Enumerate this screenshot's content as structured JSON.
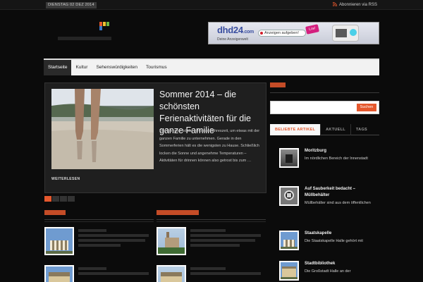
{
  "topbar": {
    "date": "DIENSTAG 02 DEZ 2014",
    "rss_label": "Abonnieren via RSS"
  },
  "header": {
    "logo_colors": [
      "#e5582d",
      "#f2c230",
      "#6cb644",
      "#3a78c8"
    ],
    "banner": {
      "brand": "dhd24",
      "brand_suffix": ".com",
      "slogan": "Deine Anzeigenwelt",
      "cta": "Anzeigen aufgeben!",
      "badge": "Los!"
    }
  },
  "nav": {
    "items": [
      "Startseite",
      "Kultur",
      "Sehenswürdigkeiten",
      "Tourismus"
    ],
    "active": "Startseite"
  },
  "featured": {
    "title": "Sommer 2014 – die schönsten Ferienaktivitäten für die ganze Familie",
    "excerpt": "Der Sommer ist die schönste Jahreszeit, um etwas mit der ganzen Familie zu unternehmen. Gerade in den Sommerferien hält es die wenigsten zu Hause. Schließlich locken die Sonne und angenehme Temperaturen – Aktivitäten für drinnen können also getrost bis zum …",
    "more_label": "WEITERLESEN"
  },
  "sidebar": {
    "search_button": "Suchen",
    "search_placeholder": "",
    "tabs": [
      "BELIEBTE ARTIKEL",
      "AKTUELL",
      "TAGS"
    ],
    "active_tab": "BELIEBTE ARTIKEL",
    "popular": [
      {
        "title": "Moritzburg",
        "desc": "Im nördlichen Bereich der Innenstadt",
        "thumb": "dark-room"
      },
      {
        "title": "Auf Sauberkeit bedacht – Müllbehälter",
        "desc": "Müllbehälter sind aus dem öffentlichen",
        "thumb": "sign"
      },
      {
        "title": "Staatskapelle",
        "desc": "Die Staatskapelle Halle gehört mit",
        "thumb": "building"
      },
      {
        "title": "Stadtbibliothek",
        "desc": "Die Großstadt Halle an der",
        "thumb": "building"
      }
    ]
  },
  "accent_color": "#e5582d"
}
